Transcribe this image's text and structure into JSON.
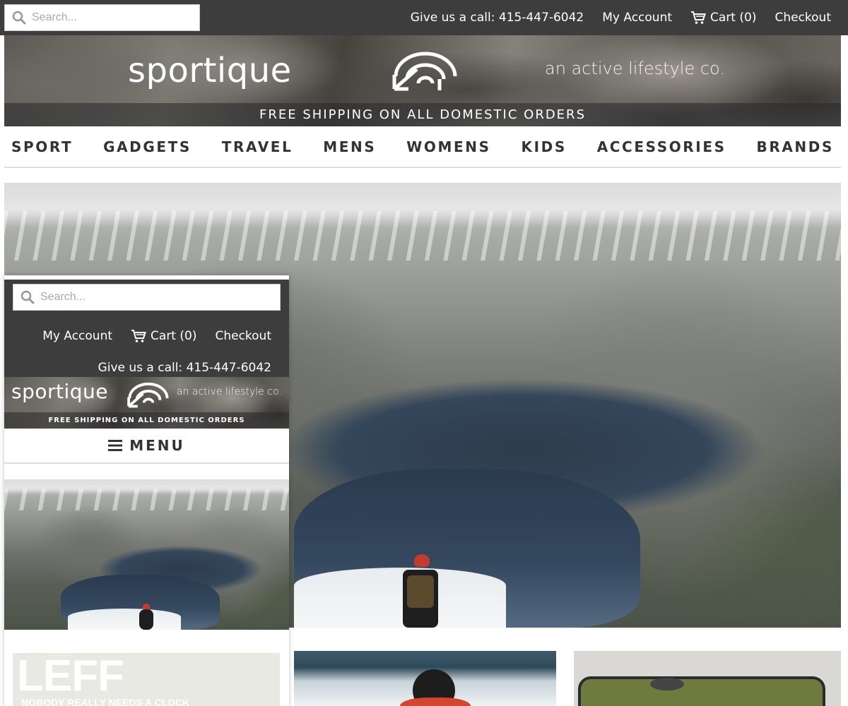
{
  "desktop": {
    "search": {
      "placeholder": "Search..."
    },
    "contact": "Give us a call: 415-447-6042",
    "my_account": "My Account",
    "cart": "Cart (0)",
    "checkout": "Checkout",
    "brand": {
      "name": "sportique",
      "tagline": "an active lifestyle co."
    },
    "shipping": "FREE SHIPPING ON ALL DOMESTIC ORDERS",
    "categories": [
      "SPORT",
      "GADGETS",
      "TRAVEL",
      "MENS",
      "WOMENS",
      "KIDS",
      "ACCESSORIES",
      "BRANDS"
    ]
  },
  "mobile": {
    "search": {
      "placeholder": "Search..."
    },
    "my_account": "My Account",
    "cart": "Cart (0)",
    "checkout": "Checkout",
    "contact": "Give us a call: 415-447-6042",
    "brand": {
      "name": "sportique",
      "tagline": "an active lifestyle co."
    },
    "shipping": "FREE SHIPPING ON ALL DOMESTIC ORDERS",
    "menu_label": "MENU"
  },
  "tiles": {
    "tile1": {
      "headline": "LEFF",
      "subline": "NOBODY REALLY NEEDS A CLOCK"
    }
  },
  "colors": {
    "topbar": "#3d3d3d",
    "nav_text": "#333333",
    "accent_red": "#c43a2c"
  }
}
